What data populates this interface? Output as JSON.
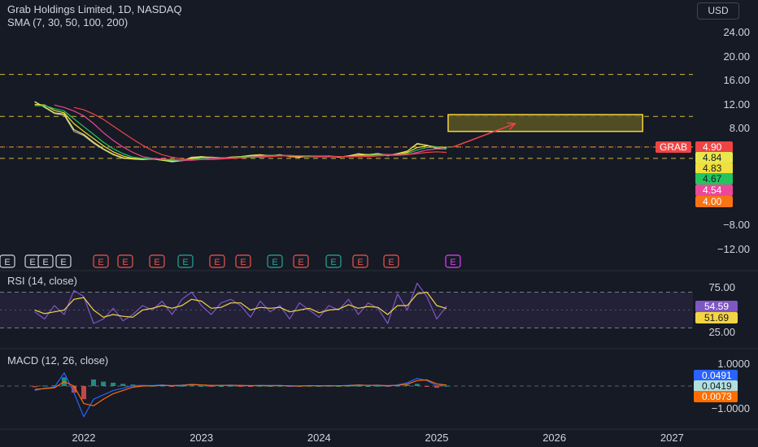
{
  "header": {
    "title": "Grab Holdings Limited, 1D, NASDAQ",
    "indicator": "SMA (7, 30, 50, 100, 200)"
  },
  "currency_button": "USD",
  "panes": {
    "rsi_label": "RSI (14, close)",
    "macd_label": "MACD (12, 26, close)"
  },
  "colors": {
    "background": "#161a25",
    "price": "#c2c2c2",
    "sma7": "#e8e84d",
    "sma30": "#f0df3c",
    "sma50": "#22c55e",
    "sma100": "#ec4899",
    "sma200": "#ef4444",
    "box_fill": "#5a5624",
    "box_stroke": "#f5d442",
    "arrow": "#ef4444",
    "rsi": "#7e57c2",
    "rsi_ma": "#f5d442",
    "macd": "#2962ff",
    "signal": "#ff6d00",
    "hist_pos": "#26a69a",
    "hist_neg": "#ef5350",
    "earnings_red": "#ef5350",
    "earnings_green": "#26a69a",
    "earnings_white": "#d1d4dc",
    "earnings_pink": "#e040fb"
  },
  "chart_data": [
    {
      "type": "line",
      "pane": "price",
      "x_ticks": [
        "2022",
        "2023",
        "2024",
        "2025",
        "2026",
        "2027"
      ],
      "y_ticks": [
        "24.00",
        "20.00",
        "16.00",
        "12.00",
        "8.00",
        "−8.00",
        "−12.00"
      ],
      "x": [
        "2021-08",
        "2021-09",
        "2021-10",
        "2021-11",
        "2021-12",
        "2022-01",
        "2022-02",
        "2022-03",
        "2022-04",
        "2022-05",
        "2022-06",
        "2022-07",
        "2022-08",
        "2022-09",
        "2022-10",
        "2022-11",
        "2022-12",
        "2023-01",
        "2023-02",
        "2023-03",
        "2023-04",
        "2023-05",
        "2023-06",
        "2023-07",
        "2023-08",
        "2023-09",
        "2023-10",
        "2023-11",
        "2023-12",
        "2024-01",
        "2024-02",
        "2024-03",
        "2024-04",
        "2024-05",
        "2024-06",
        "2024-07",
        "2024-08",
        "2024-09",
        "2024-10",
        "2024-11",
        "2024-12",
        "2025-01",
        "2025-02"
      ],
      "series": [
        {
          "values": [
            12.5,
            11.5,
            10.5,
            10.2,
            7.5,
            6.8,
            5.5,
            4.5,
            3.6,
            3.0,
            2.9,
            2.8,
            2.9,
            2.7,
            2.4,
            2.6,
            3.2,
            3.3,
            3.1,
            3.0,
            3.2,
            3.3,
            3.5,
            3.6,
            3.4,
            3.6,
            3.3,
            3.2,
            3.4,
            3.3,
            3.4,
            3.2,
            3.4,
            3.8,
            3.6,
            3.8,
            3.4,
            3.8,
            4.2,
            5.5,
            5.2,
            4.6,
            4.9
          ]
        },
        {
          "name": "SMA 7",
          "values": [
            12.4,
            11.6,
            10.6,
            10.4,
            7.8,
            7.0,
            5.7,
            4.6,
            3.7,
            3.1,
            2.9,
            2.8,
            2.9,
            2.7,
            2.5,
            2.6,
            3.1,
            3.3,
            3.1,
            3.0,
            3.2,
            3.3,
            3.5,
            3.6,
            3.4,
            3.6,
            3.3,
            3.2,
            3.4,
            3.3,
            3.4,
            3.2,
            3.4,
            3.7,
            3.6,
            3.8,
            3.5,
            3.8,
            4.2,
            5.4,
            5.2,
            4.7,
            4.84
          ]
        },
        {
          "name": "SMA 30",
          "values": [
            12.0,
            11.9,
            11.0,
            10.6,
            8.8,
            7.5,
            6.3,
            5.1,
            4.1,
            3.4,
            3.0,
            2.9,
            2.9,
            2.8,
            2.6,
            2.6,
            2.9,
            3.2,
            3.2,
            3.1,
            3.1,
            3.2,
            3.4,
            3.5,
            3.5,
            3.5,
            3.4,
            3.3,
            3.3,
            3.3,
            3.3,
            3.3,
            3.3,
            3.5,
            3.6,
            3.7,
            3.6,
            3.6,
            4.0,
            4.8,
            5.1,
            4.9,
            4.83
          ]
        },
        {
          "name": "SMA 50",
          "values": [
            11.8,
            11.8,
            11.3,
            10.9,
            9.6,
            8.3,
            7.0,
            5.7,
            4.6,
            3.8,
            3.2,
            3.0,
            2.9,
            2.8,
            2.7,
            2.6,
            2.8,
            3.0,
            3.1,
            3.1,
            3.1,
            3.2,
            3.3,
            3.4,
            3.5,
            3.5,
            3.4,
            3.4,
            3.3,
            3.3,
            3.3,
            3.3,
            3.3,
            3.4,
            3.5,
            3.6,
            3.6,
            3.6,
            3.8,
            4.4,
            4.8,
            4.9,
            4.67
          ]
        },
        {
          "name": "SMA 100",
          "values": [
            null,
            null,
            11.9,
            11.5,
            10.9,
            10.1,
            8.8,
            7.3,
            6.0,
            4.9,
            4.0,
            3.3,
            3.0,
            2.9,
            2.8,
            2.7,
            2.7,
            2.8,
            3.0,
            3.0,
            3.1,
            3.1,
            3.2,
            3.3,
            3.4,
            3.5,
            3.5,
            3.4,
            3.4,
            3.3,
            3.3,
            3.3,
            3.3,
            3.3,
            3.4,
            3.5,
            3.6,
            3.6,
            3.6,
            4.0,
            4.4,
            4.6,
            4.54
          ]
        },
        {
          "name": "SMA 200",
          "values": [
            null,
            null,
            null,
            null,
            11.5,
            11.1,
            10.4,
            9.5,
            8.4,
            7.3,
            6.2,
            5.2,
            4.3,
            3.6,
            3.2,
            2.9,
            2.8,
            2.8,
            2.8,
            2.9,
            3.0,
            3.1,
            3.2,
            3.2,
            3.3,
            3.4,
            3.4,
            3.4,
            3.4,
            3.4,
            3.4,
            3.3,
            3.3,
            3.3,
            3.3,
            3.4,
            3.5,
            3.5,
            3.6,
            3.8,
            4.0,
            4.1,
            4.0
          ]
        }
      ],
      "last_values": [
        {
          "label": "GRAB",
          "value": "4.90",
          "color": "#ef4444"
        },
        {
          "value": "4.84",
          "color": "#e8e84d"
        },
        {
          "value": "4.83",
          "color": "#f0df3c"
        },
        {
          "value": "4.67",
          "color": "#22c55e"
        },
        {
          "value": "4.54",
          "color": "#ec4899"
        },
        {
          "value": "4.00",
          "color": "#f97316"
        }
      ],
      "horizontal_levels": [
        17.0,
        10.0,
        4.9,
        3.0
      ],
      "target_box": {
        "x_from": "2025-01",
        "x_to": "2026-10",
        "y_from": 7.5,
        "y_to": 10.3
      },
      "arrow": {
        "from": [
          "2025-02",
          4.9
        ],
        "to": [
          "2025-09",
          8.8
        ]
      }
    },
    {
      "type": "line",
      "pane": "rsi",
      "y_ticks": [
        "75.00",
        "50.00",
        "25.00"
      ],
      "band": [
        30,
        70
      ],
      "x": [
        "2021-08",
        "2021-09",
        "2021-10",
        "2021-11",
        "2021-12",
        "2022-01",
        "2022-02",
        "2022-03",
        "2022-04",
        "2022-05",
        "2022-06",
        "2022-07",
        "2022-08",
        "2022-09",
        "2022-10",
        "2022-11",
        "2022-12",
        "2023-01",
        "2023-02",
        "2023-03",
        "2023-04",
        "2023-05",
        "2023-06",
        "2023-07",
        "2023-08",
        "2023-09",
        "2023-10",
        "2023-11",
        "2023-12",
        "2024-01",
        "2024-02",
        "2024-03",
        "2024-04",
        "2024-05",
        "2024-06",
        "2024-07",
        "2024-08",
        "2024-09",
        "2024-10",
        "2024-11",
        "2024-12",
        "2025-01",
        "2025-02"
      ],
      "series": [
        {
          "values": [
            48,
            40,
            55,
            45,
            72,
            65,
            35,
            40,
            52,
            38,
            45,
            55,
            50,
            60,
            45,
            62,
            70,
            55,
            45,
            58,
            62,
            55,
            42,
            60,
            48,
            55,
            40,
            58,
            50,
            42,
            55,
            50,
            62,
            45,
            58,
            52,
            35,
            68,
            50,
            80,
            65,
            40,
            54.59
          ]
        },
        {
          "values": [
            50,
            46,
            48,
            50,
            62,
            64,
            50,
            42,
            45,
            43,
            42,
            50,
            52,
            55,
            52,
            55,
            62,
            60,
            52,
            53,
            58,
            58,
            50,
            53,
            52,
            53,
            48,
            50,
            52,
            47,
            50,
            51,
            56,
            52,
            54,
            53,
            45,
            55,
            55,
            68,
            70,
            55,
            51.69
          ]
        }
      ],
      "last_values": [
        {
          "value": "54.59",
          "color": "#7e57c2"
        },
        {
          "value": "51.69",
          "color": "#f5d442"
        }
      ]
    },
    {
      "type": "line",
      "pane": "macd",
      "y_ticks": [
        "1.0000",
        "−1.0000"
      ],
      "x": [
        "2021-08",
        "2021-09",
        "2021-10",
        "2021-11",
        "2021-12",
        "2022-01",
        "2022-02",
        "2022-03",
        "2022-04",
        "2022-05",
        "2022-06",
        "2022-07",
        "2022-08",
        "2022-09",
        "2022-10",
        "2022-11",
        "2022-12",
        "2023-01",
        "2023-02",
        "2023-03",
        "2023-04",
        "2023-05",
        "2023-06",
        "2023-07",
        "2023-08",
        "2023-09",
        "2023-10",
        "2023-11",
        "2023-12",
        "2024-01",
        "2024-02",
        "2024-03",
        "2024-04",
        "2024-05",
        "2024-06",
        "2024-07",
        "2024-08",
        "2024-09",
        "2024-10",
        "2024-11",
        "2024-12",
        "2025-01",
        "2025-02"
      ],
      "series": [
        {
          "values": [
            -0.2,
            -0.1,
            -0.05,
            0.6,
            -0.3,
            -1.4,
            -0.6,
            -0.4,
            -0.2,
            -0.1,
            0.02,
            0.03,
            0.02,
            0.05,
            0.01,
            0.04,
            0.08,
            0.05,
            0.02,
            0.03,
            0.04,
            0.02,
            0.01,
            0.03,
            0.02,
            0.03,
            -0.01,
            0.0,
            0.02,
            0.01,
            0.02,
            0.01,
            0.03,
            0.05,
            0.03,
            0.04,
            0.0,
            0.05,
            0.15,
            0.35,
            0.25,
            0.02,
            0.0491
          ]
        },
        {
          "values": [
            -0.15,
            -0.12,
            -0.08,
            0.2,
            0.0,
            -0.8,
            -0.9,
            -0.6,
            -0.35,
            -0.2,
            -0.05,
            0.0,
            0.01,
            0.03,
            0.02,
            0.03,
            0.06,
            0.05,
            0.03,
            0.03,
            0.03,
            0.03,
            0.02,
            0.02,
            0.02,
            0.02,
            0.01,
            0.0,
            0.01,
            0.01,
            0.01,
            0.01,
            0.02,
            0.04,
            0.03,
            0.03,
            0.02,
            0.03,
            0.09,
            0.25,
            0.28,
            0.1,
            0.0419
          ]
        }
      ],
      "histogram": [
        -0.05,
        0.02,
        0.03,
        0.4,
        -0.3,
        -0.6,
        0.3,
        0.2,
        0.15,
        0.1,
        0.07,
        0.03,
        0.01,
        0.02,
        -0.01,
        0.01,
        0.02,
        0.0,
        -0.01,
        0.0,
        0.01,
        -0.01,
        -0.01,
        0.01,
        0.0,
        0.01,
        -0.02,
        0.0,
        0.01,
        0.0,
        0.01,
        0.0,
        0.01,
        0.01,
        0.0,
        0.01,
        -0.02,
        0.02,
        0.06,
        0.1,
        -0.03,
        -0.08,
        0.0073
      ],
      "last_values": [
        {
          "value": "0.0491",
          "color": "#2962ff"
        },
        {
          "value": "0.0419",
          "color": "#b2dfdb"
        },
        {
          "value": "0.0073",
          "color": "#ff6d00"
        }
      ]
    }
  ],
  "earnings_markers": [
    {
      "label": "E",
      "color": "#d1d4dc"
    },
    {
      "label": "E",
      "color": "#d1d4dc"
    },
    {
      "label": "E",
      "color": "#d1d4dc"
    },
    {
      "label": "E",
      "color": "#d1d4dc"
    },
    {
      "label": "E",
      "color": "#ef5350"
    },
    {
      "label": "E",
      "color": "#ef5350"
    },
    {
      "label": "E",
      "color": "#ef5350"
    },
    {
      "label": "E",
      "color": "#26a69a"
    },
    {
      "label": "E",
      "color": "#ef5350"
    },
    {
      "label": "E",
      "color": "#ef5350"
    },
    {
      "label": "E",
      "color": "#26a69a"
    },
    {
      "label": "E",
      "color": "#ef5350"
    },
    {
      "label": "E",
      "color": "#26a69a"
    },
    {
      "label": "E",
      "color": "#ef5350"
    },
    {
      "label": "E",
      "color": "#ef5350"
    },
    {
      "label": "E",
      "color": "#e040fb"
    }
  ]
}
